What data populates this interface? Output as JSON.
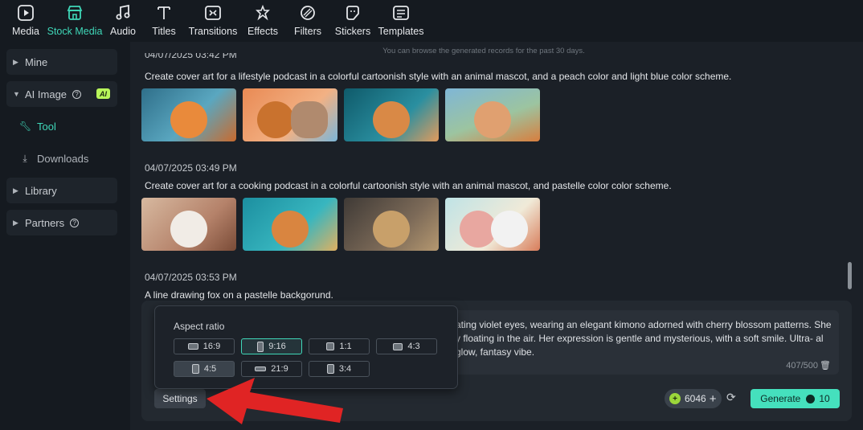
{
  "toolbar": {
    "items": [
      {
        "label": "Media",
        "icon": "media-icon"
      },
      {
        "label": "Stock Media",
        "icon": "stock-media-icon",
        "active": true
      },
      {
        "label": "Audio",
        "icon": "audio-icon"
      },
      {
        "label": "Titles",
        "icon": "titles-icon"
      },
      {
        "label": "Transitions",
        "icon": "transitions-icon"
      },
      {
        "label": "Effects",
        "icon": "effects-icon"
      },
      {
        "label": "Filters",
        "icon": "filters-icon"
      },
      {
        "label": "Stickers",
        "icon": "stickers-icon"
      },
      {
        "label": "Templates",
        "icon": "templates-icon"
      }
    ]
  },
  "sidebar": {
    "mine": "Mine",
    "ai_image": "AI Image",
    "ai_badge": "AI",
    "tool": "Tool",
    "downloads": "Downloads",
    "library": "Library",
    "partners": "Partners"
  },
  "main": {
    "notice": "You can browse the generated records for the past 30 days.",
    "records": [
      {
        "date": "04/07/2025 03:42 PM",
        "prompt": "Create cover art for a lifestyle podcast in a colorful cartoonish style with an animal mascot, and a peach color and light blue color scheme."
      },
      {
        "date": "04/07/2025 03:49 PM",
        "prompt": "Create cover art for a cooking podcast in a colorful cartoonish style with an animal mascot, and pastelle color color scheme."
      },
      {
        "date": "04/07/2025 03:53 PM",
        "prompt": "A line drawing fox on a pastelle backgorund."
      }
    ]
  },
  "composer": {
    "prompt_visible": "ating violet eyes, wearing an elegant kimono adorned with cherry blossom patterns. She y floating in the air. Her expression is gentle and mysterious, with a soft smile. Ultra- al glow, fantasy vibe.",
    "counter": "407/500",
    "settings_label": "Settings",
    "credits": "6046",
    "generate_label": "Generate",
    "generate_cost": "10"
  },
  "aspect_popup": {
    "title": "Aspect ratio",
    "options": [
      "16:9",
      "9:16",
      "1:1",
      "4:3",
      "4:5",
      "21:9",
      "3:4"
    ],
    "selected": "9:16",
    "hovered": "4:5"
  },
  "colors": {
    "accent": "#3fd7b8",
    "generate": "#45e0bd",
    "annotation_arrow": "#e02424"
  }
}
